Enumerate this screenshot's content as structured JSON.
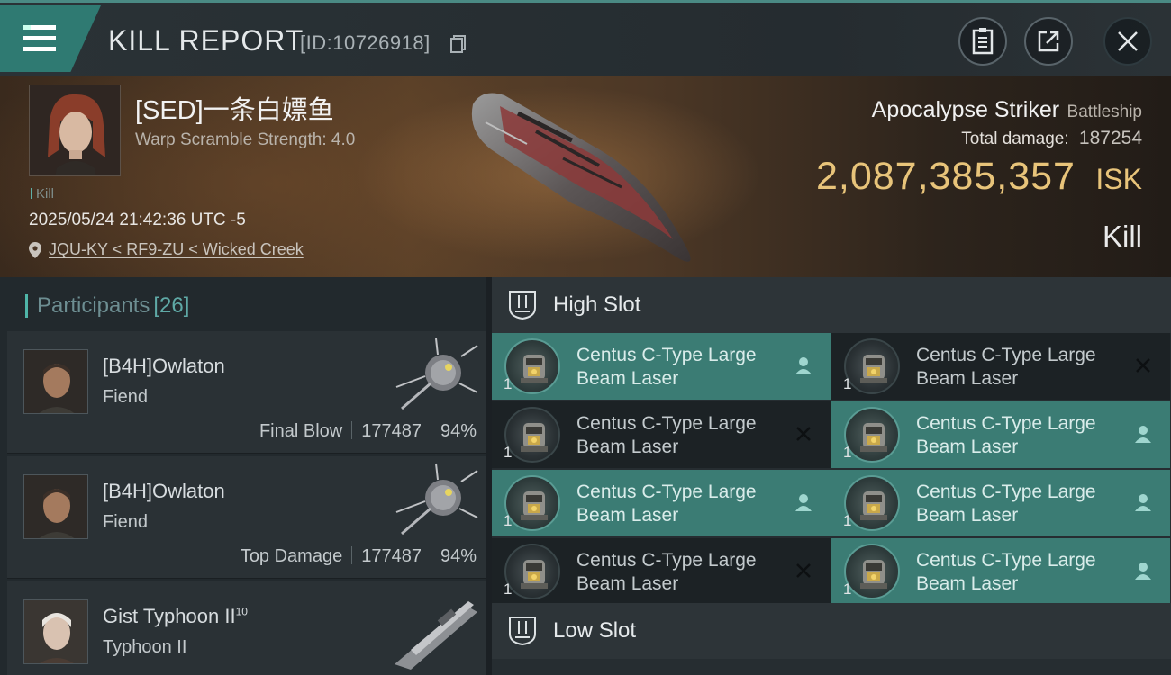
{
  "header": {
    "title": "KILL REPORT",
    "report_id": "[ID:10726918]"
  },
  "victim": {
    "name": "[SED]一条白嫖鱼",
    "warp_scramble": "Warp Scramble Strength: 4.0",
    "tag": "Kill",
    "datetime": "2025/05/24 21:42:36 UTC -5",
    "location": "JQU-KY < RF9-ZU < Wicked Creek",
    "ship_name": "Apocalypse Striker",
    "ship_class": "Battleship",
    "total_damage_label": "Total damage:",
    "total_damage": "187254",
    "isk_value": "2,087,385,357",
    "isk_unit": "ISK",
    "result": "Kill"
  },
  "participants": {
    "label": "Participants",
    "count": "[26]",
    "rows": [
      {
        "name": "[B4H]Owlaton",
        "ship": "Fiend",
        "role": "Final Blow",
        "damage": "177487",
        "percent": "94%"
      },
      {
        "name": "[B4H]Owlaton",
        "ship": "Fiend",
        "role": "Top Damage",
        "damage": "177487",
        "percent": "94%"
      },
      {
        "name": "Gist Typhoon II",
        "sup": "10",
        "ship": "Typhoon II"
      }
    ]
  },
  "slots": {
    "high_label": "High Slot",
    "low_label": "Low Slot",
    "high": [
      {
        "name": "Centus C-Type Large Beam Laser",
        "qty": "1",
        "status": "fitted"
      },
      {
        "name": "Centus C-Type Large Beam Laser",
        "qty": "1",
        "status": "destroyed"
      },
      {
        "name": "Centus C-Type Large Beam Laser",
        "qty": "1",
        "status": "destroyed"
      },
      {
        "name": "Centus C-Type Large Beam Laser",
        "qty": "1",
        "status": "fitted"
      },
      {
        "name": "Centus C-Type Large Beam Laser",
        "qty": "1",
        "status": "fitted"
      },
      {
        "name": "Centus C-Type Large Beam Laser",
        "qty": "1",
        "status": "fitted"
      },
      {
        "name": "Centus C-Type Large Beam Laser",
        "qty": "1",
        "status": "destroyed"
      },
      {
        "name": "Centus C-Type Large Beam Laser",
        "qty": "1",
        "status": "fitted"
      }
    ]
  },
  "icons": {
    "menu": "menu-icon",
    "copy": "copy-icon",
    "clipboard": "clipboard-icon",
    "share": "share-icon",
    "close": "close-icon",
    "location": "location-pin-icon",
    "slot": "slot-icon",
    "dropped": "person-icon",
    "destroyed": "x-icon"
  },
  "colors": {
    "accent": "#3b7c74",
    "isk": "#e8c47a",
    "header_accent": "#4a8a84"
  }
}
